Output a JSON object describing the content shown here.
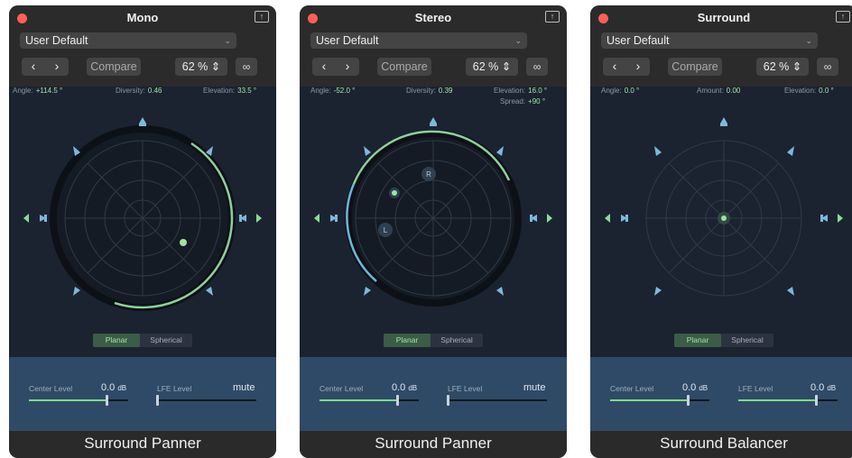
{
  "colors": {
    "accent": "#9fe3a0",
    "panel_bg": "#1b2330",
    "lower_bg": "#2f4a66",
    "speaker": "#7fb8d8",
    "close": "#ff5f57"
  },
  "panels": [
    {
      "window_title": "Mono",
      "preset": "User Default",
      "compare": "Compare",
      "zoom": "62 %",
      "params": [
        {
          "label": "Angle:",
          "value": "+114.5 °"
        },
        {
          "label": "Diversity:",
          "value": "0.46"
        },
        {
          "label": "Elevation:",
          "value": "33.5 °"
        }
      ],
      "extra_param": null,
      "mode_planar": "Planar",
      "mode_spherical": "Spherical",
      "center_label": "Center Level",
      "center_value": "0.0",
      "center_unit": "dB",
      "center_fill": 0.78,
      "lfe_label": "LFE Level",
      "lfe_value": "mute",
      "lfe_unit": "",
      "lfe_fill": 0.0,
      "footer": "Surround Panner"
    },
    {
      "window_title": "Stereo",
      "preset": "User Default",
      "compare": "Compare",
      "zoom": "62 %",
      "params": [
        {
          "label": "Angle:",
          "value": "-52.0 °"
        },
        {
          "label": "Diversity:",
          "value": "0.39"
        },
        {
          "label": "Elevation:",
          "value": "16.0 °"
        }
      ],
      "extra_param": {
        "label": "Spread:",
        "value": "+90 °"
      },
      "mode_planar": "Planar",
      "mode_spherical": "Spherical",
      "channel_left": "L",
      "channel_right": "R",
      "center_label": "Center Level",
      "center_value": "0.0",
      "center_unit": "dB",
      "center_fill": 0.78,
      "lfe_label": "LFE Level",
      "lfe_value": "mute",
      "lfe_unit": "",
      "lfe_fill": 0.0,
      "footer": "Surround Panner"
    },
    {
      "window_title": "Surround",
      "preset": "User Default",
      "compare": "Compare",
      "zoom": "62 %",
      "params": [
        {
          "label": "Angle:",
          "value": "0.0 °"
        },
        {
          "label": "Amount:",
          "value": "0.00"
        },
        {
          "label": "Elevation:",
          "value": "0.0 °"
        }
      ],
      "extra_param": null,
      "mode_planar": "Planar",
      "mode_spherical": "Spherical",
      "center_label": "Center Level",
      "center_value": "0.0",
      "center_unit": "dB",
      "center_fill": 0.78,
      "lfe_label": "LFE Level",
      "lfe_value": "0.0",
      "lfe_unit": "dB",
      "lfe_fill": 0.78,
      "footer": "Surround Balancer"
    }
  ]
}
